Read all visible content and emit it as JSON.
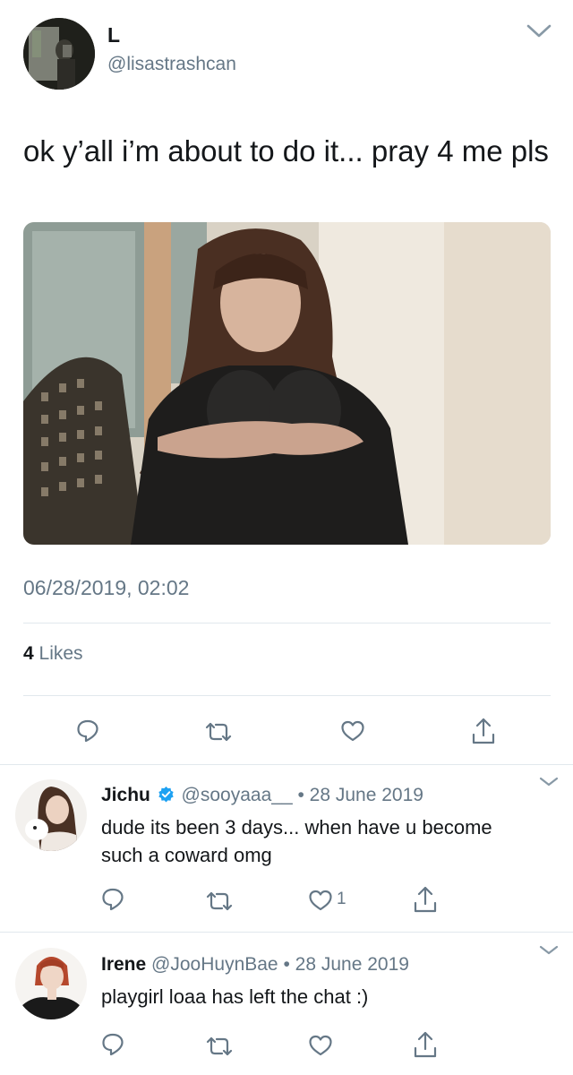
{
  "tweet": {
    "display_name": "L",
    "handle": "@lisastrashcan",
    "text": "ok y’all i’m about to do it... pray 4 me pls",
    "timestamp": "06/28/2019, 02:02",
    "likes_count": "4",
    "likes_label": "Likes"
  },
  "replies": [
    {
      "name": "Jichu",
      "verified": true,
      "handle": "@sooyaaa__",
      "dot": "•",
      "date": "28 June 2019",
      "text": "dude its been 3 days... when have u become such a coward omg",
      "like_count": "1"
    },
    {
      "name": "Irene",
      "verified": false,
      "handle": "@JooHuynBae",
      "dot": "•",
      "date": "28 June 2019",
      "text": "playgirl loaa has left the chat :)",
      "like_count": ""
    }
  ],
  "icons": [
    "chevron-down-icon",
    "reply-icon",
    "retweet-icon",
    "like-icon",
    "share-icon",
    "verified-icon"
  ],
  "colors": {
    "text": "#14171a",
    "secondary": "#657786",
    "divider": "#e1e8ed",
    "verified": "#1da1f2"
  }
}
